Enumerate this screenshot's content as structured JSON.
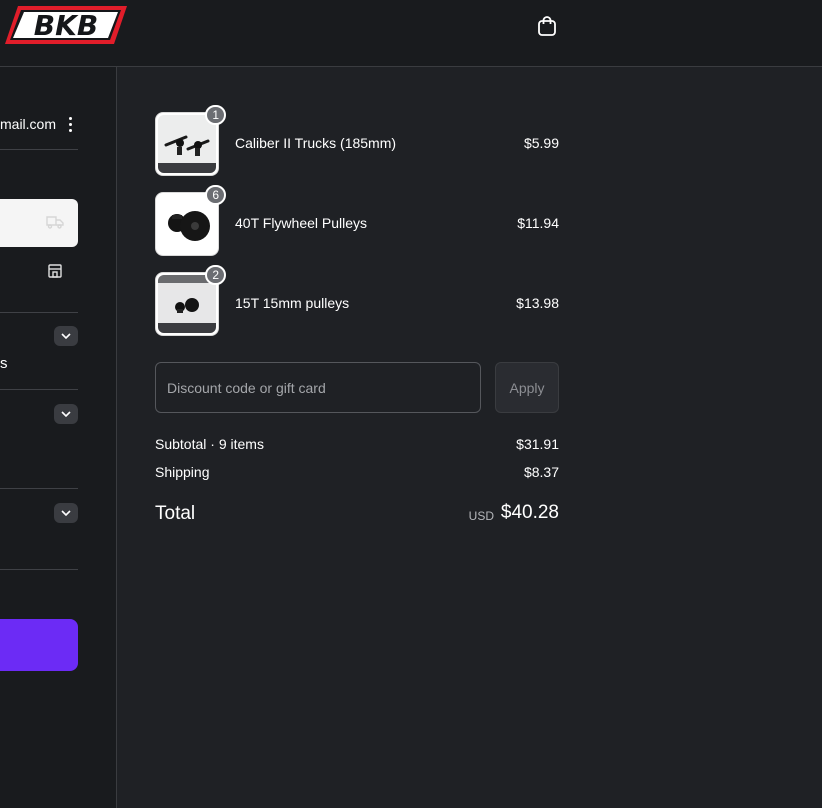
{
  "header": {
    "logo_text": "BKB",
    "cart_icon": "shopping-bag-icon"
  },
  "left": {
    "email_partial": "mail.com",
    "s_text": "s",
    "icons": [
      "kebab-icon",
      "truck-icon",
      "store-icon",
      "chevron-down-icon"
    ]
  },
  "colors": {
    "background": "#1f2125",
    "header": "#191b1e",
    "pay_button": "#6c2bf5",
    "badge": "#6b6d72"
  },
  "items": [
    {
      "quantity": "1",
      "name": "Caliber II Trucks (185mm)",
      "price": "$5.99"
    },
    {
      "quantity": "6",
      "name": "40T Flywheel Pulleys",
      "price": "$11.94"
    },
    {
      "quantity": "2",
      "name": "15T 15mm pulleys",
      "price": "$13.98"
    }
  ],
  "discount": {
    "placeholder": "Discount code or gift card",
    "apply_label": "Apply"
  },
  "totals": {
    "subtotal_label": "Subtotal · 9 items",
    "subtotal_value": "$31.91",
    "shipping_label": "Shipping",
    "shipping_value": "$8.37",
    "total_label": "Total",
    "currency": "USD",
    "total_value": "$40.28"
  }
}
